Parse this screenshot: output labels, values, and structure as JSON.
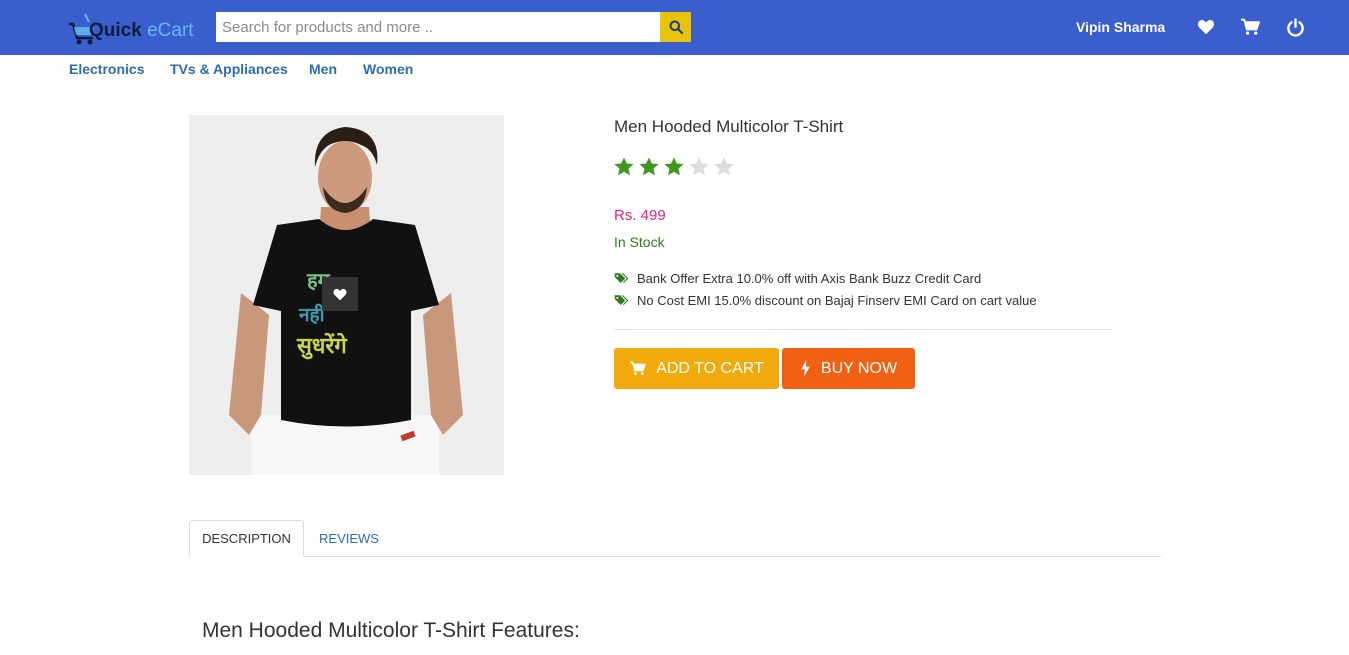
{
  "header": {
    "logo_quick": "Quick",
    "logo_ecart": "eCart",
    "search_placeholder": "Search for products and more ..",
    "user_name": "Vipin Sharma",
    "icons": [
      "heart-icon",
      "cart-icon",
      "power-icon"
    ]
  },
  "nav": {
    "items": [
      {
        "label": "Electronics"
      },
      {
        "label": "TVs & Appliances"
      },
      {
        "label": "Men"
      },
      {
        "label": "Women"
      }
    ]
  },
  "product": {
    "title": "Men Hooded Multicolor T-Shirt",
    "rating": 3,
    "rating_max": 5,
    "price": "Rs. 499",
    "stock": "In Stock",
    "offers": [
      "Bank Offer Extra 10.0% off with Axis Bank Buzz Credit Card",
      "No Cost EMI 15.0% discount on Bajaj Finserv EMI Card on cart value"
    ],
    "add_to_cart": "ADD TO CART",
    "buy_now": "BUY NOW",
    "shirt_print": [
      "हम",
      "नहीं",
      "सुधरेंगे"
    ]
  },
  "tabs": {
    "description": "DESCRIPTION",
    "reviews": "REVIEWS"
  },
  "details": {
    "features_heading": "Men Hooded Multicolor T-Shirt Features:"
  },
  "colors": {
    "header_bg": "#3a5fcd",
    "search_btn": "#e8c30c",
    "star_filled": "#3d9a1d",
    "star_empty": "#dddddd",
    "price": "#e2237c",
    "in_stock": "#2c7d1e",
    "add_to_cart_bg": "#f2a90c",
    "buy_now_bg": "#f26113",
    "nav_link": "#2d6cb1"
  }
}
